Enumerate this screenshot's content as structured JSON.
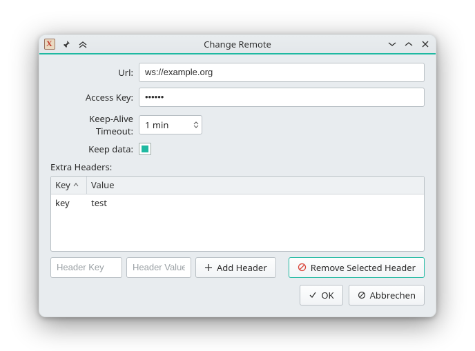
{
  "window": {
    "title": "Change Remote"
  },
  "form": {
    "url_label": "Url:",
    "url_value": "ws://example.org",
    "access_key_label": "Access Key:",
    "access_key_value": "••••••",
    "timeout_label": "Keep-Alive Timeout:",
    "timeout_value": "1 min",
    "keep_data_label": "Keep data:",
    "keep_data_checked": true
  },
  "extra_headers": {
    "section_label": "Extra Headers:",
    "columns": {
      "key": "Key",
      "value": "Value"
    },
    "rows": [
      {
        "key": "key",
        "value": "test"
      }
    ],
    "key_placeholder": "Header Key",
    "value_placeholder": "Header Value",
    "add_label": "Add Header",
    "remove_label": "Remove Selected Header"
  },
  "footer": {
    "ok": "OK",
    "cancel": "Abbrechen"
  }
}
